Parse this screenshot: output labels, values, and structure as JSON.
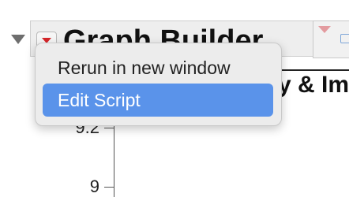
{
  "header": {
    "title": "Graph Builder"
  },
  "chart": {
    "title_fragment": "y & Im"
  },
  "axis": {
    "ticks": [
      "9.2",
      "9"
    ]
  },
  "menu": {
    "items": [
      {
        "label": "Rerun in new window",
        "selected": false
      },
      {
        "label": "Edit Script",
        "selected": true
      }
    ],
    "selected_color": "#5a93ea"
  },
  "colors": {
    "hotspot_red": "#d6262a"
  }
}
